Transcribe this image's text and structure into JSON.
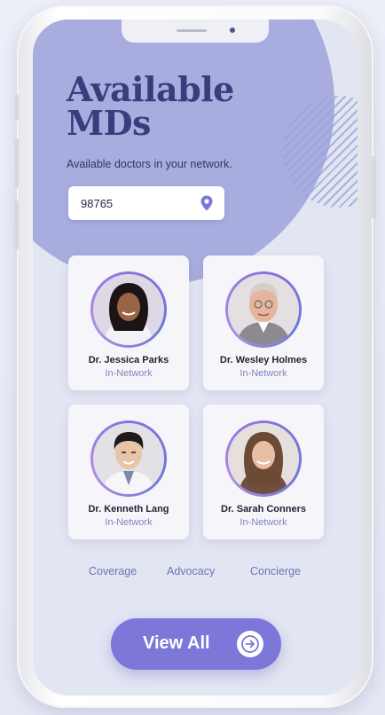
{
  "header": {
    "title_line1": "Available",
    "title_line2": "MDs",
    "subtitle": "Available doctors in your network."
  },
  "search": {
    "value": "98765",
    "icon": "location-pin-icon"
  },
  "doctors": [
    {
      "name": "Dr. Jessica Parks",
      "network": "In-Network"
    },
    {
      "name": "Dr. Wesley Holmes",
      "network": "In-Network"
    },
    {
      "name": "Dr. Kenneth Lang",
      "network": "In-Network"
    },
    {
      "name": "Dr. Sarah Conners",
      "network": "In-Network"
    }
  ],
  "nav": {
    "items": [
      "Coverage",
      "Advocacy",
      "Concierge"
    ]
  },
  "cta": {
    "label": "View All",
    "icon": "arrow-right-circle-icon"
  },
  "colors": {
    "brand": "#7c77d8",
    "heading": "#3a3d7c",
    "accent_blob": "#a8acdf",
    "network_text": "#7f84c0"
  }
}
